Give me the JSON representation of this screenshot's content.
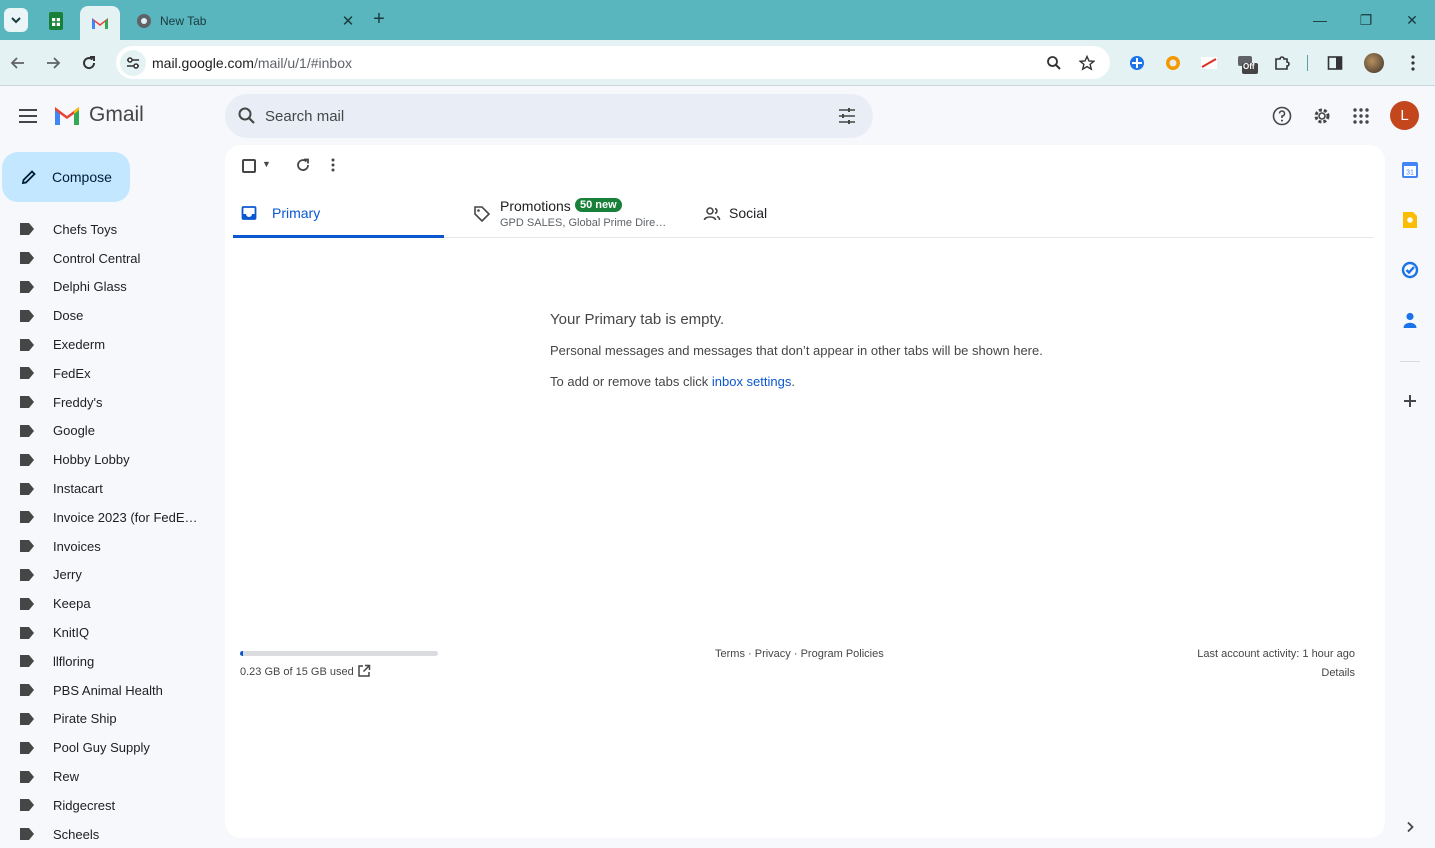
{
  "browser": {
    "tabs": [
      {
        "kind": "pinned",
        "icon": "google-sheets-icon"
      },
      {
        "kind": "pinned",
        "icon": "gmail-icon",
        "active": true
      },
      {
        "kind": "normal",
        "title": "New Tab",
        "icon": "chrome-icon"
      }
    ],
    "new_tab_symbol": "+",
    "window_controls": {
      "minimize": "—",
      "restore": "❐",
      "close": "✕"
    },
    "address": {
      "host": "mail.google.com",
      "path": "/mail/u/1/#inbox"
    },
    "extensions": [
      "extension-blue-icon",
      "extension-orange-icon",
      "extension-redlogo-icon",
      "extension-off-icon",
      "extensions-puzzle-icon",
      "side-panel-icon"
    ],
    "extension_off_badge": "Off"
  },
  "gmail": {
    "product_name": "Gmail",
    "search": {
      "placeholder": "Search mail"
    },
    "avatar_initial": "L",
    "compose_label": "Compose",
    "labels": [
      "Chefs Toys",
      "Control Central",
      "Delphi Glass",
      "Dose",
      "Exederm",
      "FedEx",
      "Freddy's",
      "Google",
      "Hobby Lobby",
      "Instacart",
      "Invoice 2023 (for FedEx ...",
      "Invoices",
      "Jerry",
      "Keepa",
      "KnitIQ",
      "llfloring",
      "PBS Animal Health",
      "Pirate Ship",
      "Pool Guy Supply",
      "Rew",
      "Ridgecrest",
      "Scheels"
    ],
    "category_tabs": {
      "primary": "Primary",
      "promotions": "Promotions",
      "promotions_badge": "50 new",
      "promotions_snippet": "GPD SALES, Global Prime Direct...",
      "social": "Social"
    },
    "empty_state": {
      "title": "Your Primary tab is empty.",
      "line1": "Personal messages and messages that don’t appear in other tabs will be shown here.",
      "line2_prefix": "To add or remove tabs click ",
      "line2_link": "inbox settings",
      "line2_suffix": "."
    },
    "storage": {
      "text": "0.23 GB of 15 GB used",
      "used_fraction": 0.015
    },
    "footer": {
      "terms": "Terms",
      "privacy": "Privacy",
      "policies": "Program Policies",
      "sep": " · "
    },
    "activity": {
      "text": "Last account activity: 1 hour ago",
      "details": "Details"
    }
  },
  "colors": {
    "accent": "#0b57d0",
    "compose_bg": "#c2e7ff",
    "badge_green": "#188038",
    "avatar_bg": "#c3461d",
    "tabstrip": "#5ab6be"
  }
}
